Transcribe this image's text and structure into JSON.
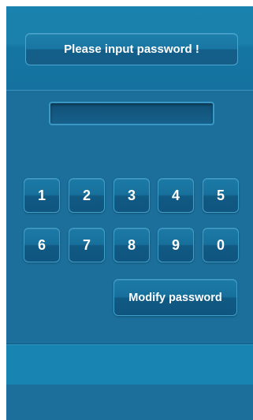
{
  "header": {
    "title": "Please input password !"
  },
  "password": {
    "value": "",
    "placeholder": ""
  },
  "keypad": {
    "keys": [
      "1",
      "2",
      "3",
      "4",
      "5",
      "6",
      "7",
      "8",
      "9",
      "0"
    ]
  },
  "actions": {
    "modify_label": "Modify password"
  },
  "colors": {
    "background": "#1b6f9a",
    "button_border": "#3f9fcb",
    "text": "#ffffff"
  }
}
